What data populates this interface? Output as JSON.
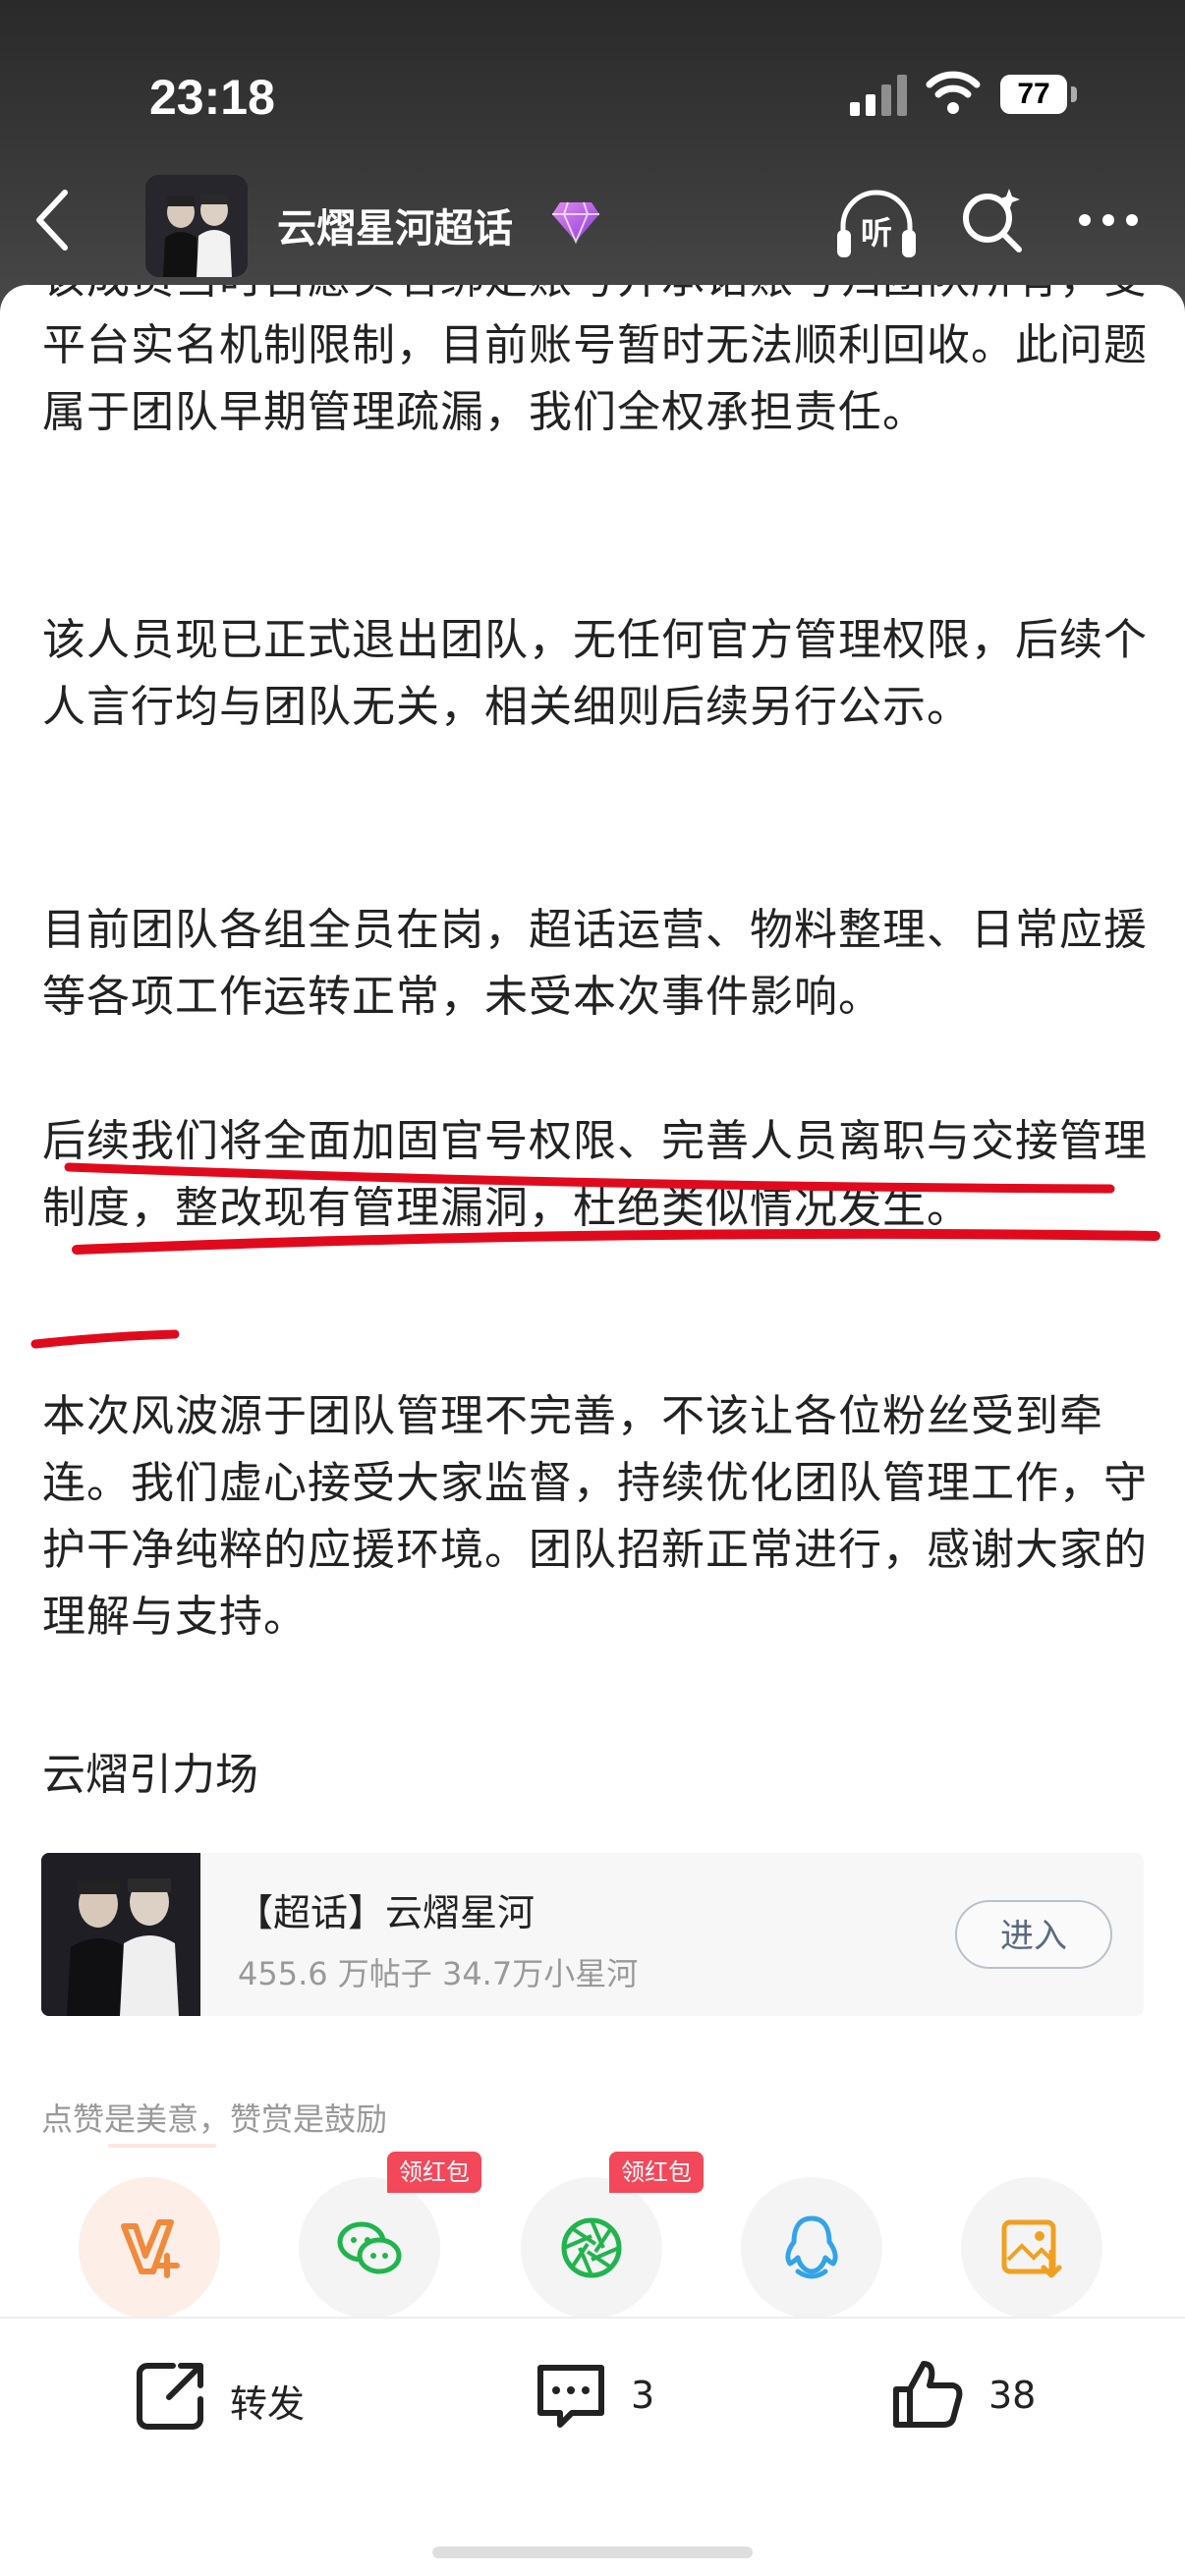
{
  "status_bar": {
    "time": "23:18",
    "battery": "77"
  },
  "nav": {
    "title": "云熠星河超话",
    "listen_label": "听"
  },
  "article": {
    "paragraphs": [
      "该成员当时自愿实名绑定账号并承诺账号归团队所有，受平台实名机制限制，目前账号暂时无法顺利回收。此问题属于团队早期管理疏漏，我们全权承担责任。",
      "该人员现已正式退出团队，无任何官方管理权限，后续个人言行均与团队无关，相关细则后续另行公示。",
      "目前团队各组全员在岗，超话运营、物料整理、日常应援等各项工作运转正常，未受本次事件影响。",
      "后续我们将全面加固官号权限、完善人员离职与交接管理制度，整改现有管理漏洞，杜绝类似情况发生。",
      "本次风波源于团队管理不完善，不该让各位粉丝受到牵连。我们虚心接受大家监督，持续优化团队管理工作，守护干净纯粹的应援环境。团队招新正常进行，感谢大家的理解与支持。"
    ],
    "signature": "云熠引力场"
  },
  "topic_card": {
    "name": "【超话】云熠星河",
    "stats": "455.6 万帖子 34.7万小星河",
    "enter_label": "进入"
  },
  "like_hint": "点赞是美意，赞赏是鼓励",
  "share_badges": {
    "wechat": "领红包",
    "moments": "领红包"
  },
  "bottom_bar": {
    "repost": "转发",
    "comments": "3",
    "likes": "38"
  },
  "colors": {
    "accent_orange": "#f08a3c",
    "wechat_green": "#21b44d",
    "qq_blue": "#33a3e8",
    "badge_red": "#f2485a",
    "annotation_red": "#e10a1d",
    "gem_purple": "#b44de0"
  }
}
